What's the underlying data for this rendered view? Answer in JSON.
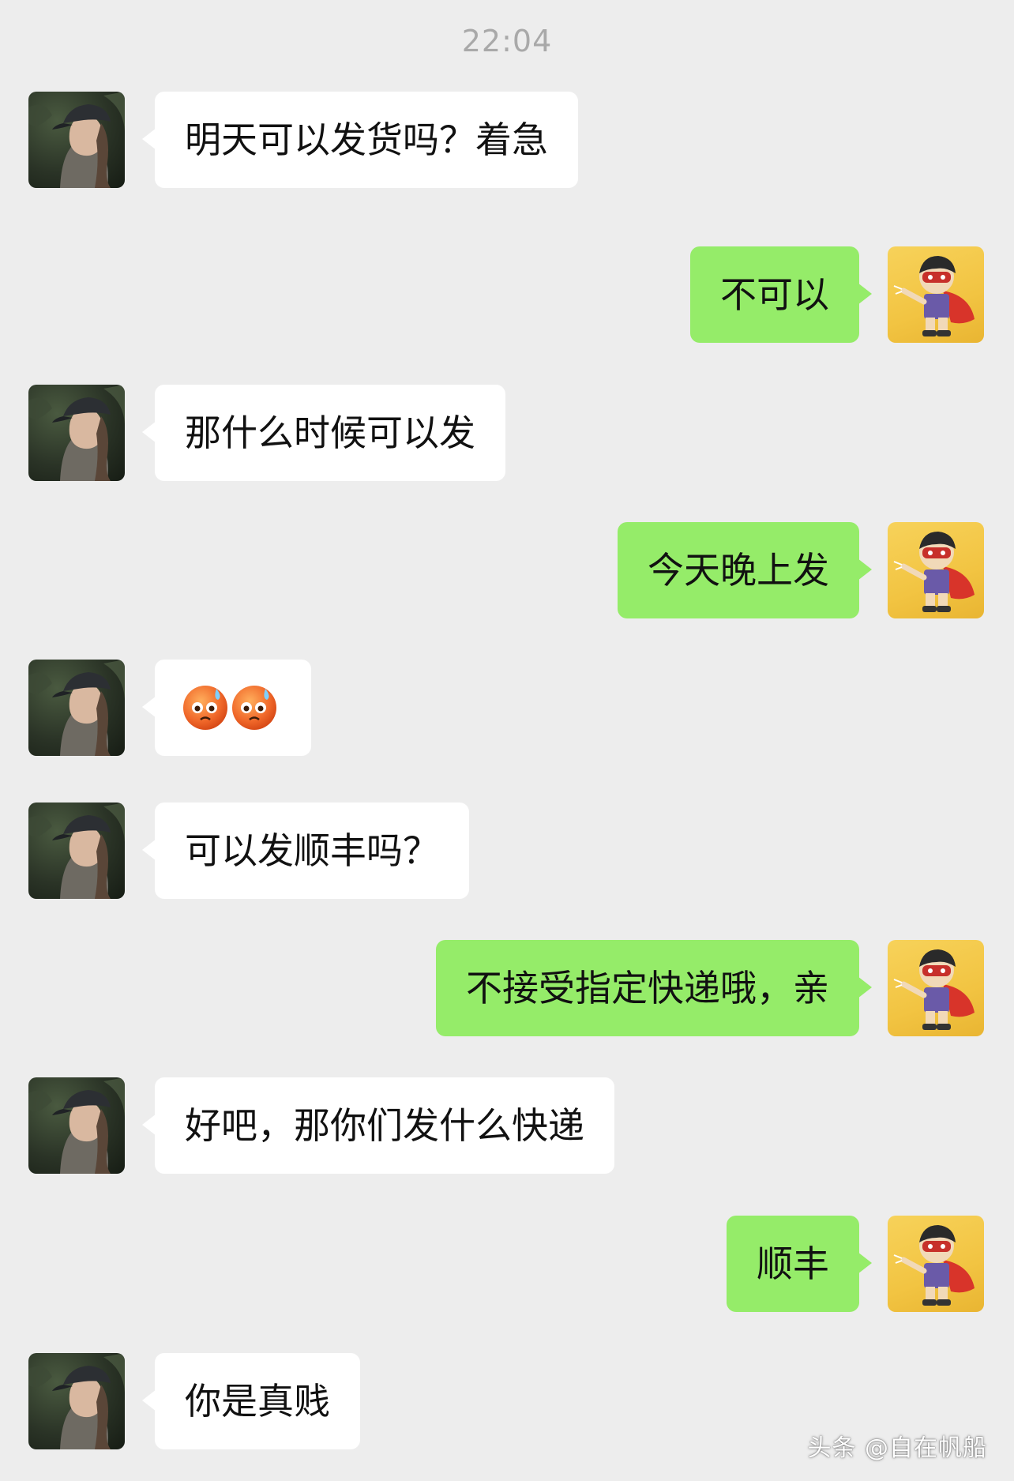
{
  "chat": {
    "timestamp": "22:04",
    "messages": [
      {
        "side": "left",
        "text": "明天可以发货吗？着急"
      },
      {
        "side": "right",
        "text": "不可以"
      },
      {
        "side": "left",
        "text": "那什么时候可以发"
      },
      {
        "side": "right",
        "text": "今天晚上发"
      },
      {
        "side": "left",
        "type": "emoji",
        "emoji": [
          "sweating-face-icon",
          "sweating-face-icon"
        ]
      },
      {
        "side": "left",
        "text": "可以发顺丰吗？"
      },
      {
        "side": "right",
        "text": "不接受指定快递哦，亲"
      },
      {
        "side": "left",
        "text": "好吧，那你们发什么快递"
      },
      {
        "side": "right",
        "text": "顺丰"
      },
      {
        "side": "left",
        "text": "你是真贱"
      }
    ]
  },
  "colors": {
    "background": "#ededed",
    "incoming_bubble": "#ffffff",
    "outgoing_bubble": "#95ec69",
    "timestamp": "#a9a9a9"
  },
  "watermark": "头条 @自在帆船"
}
